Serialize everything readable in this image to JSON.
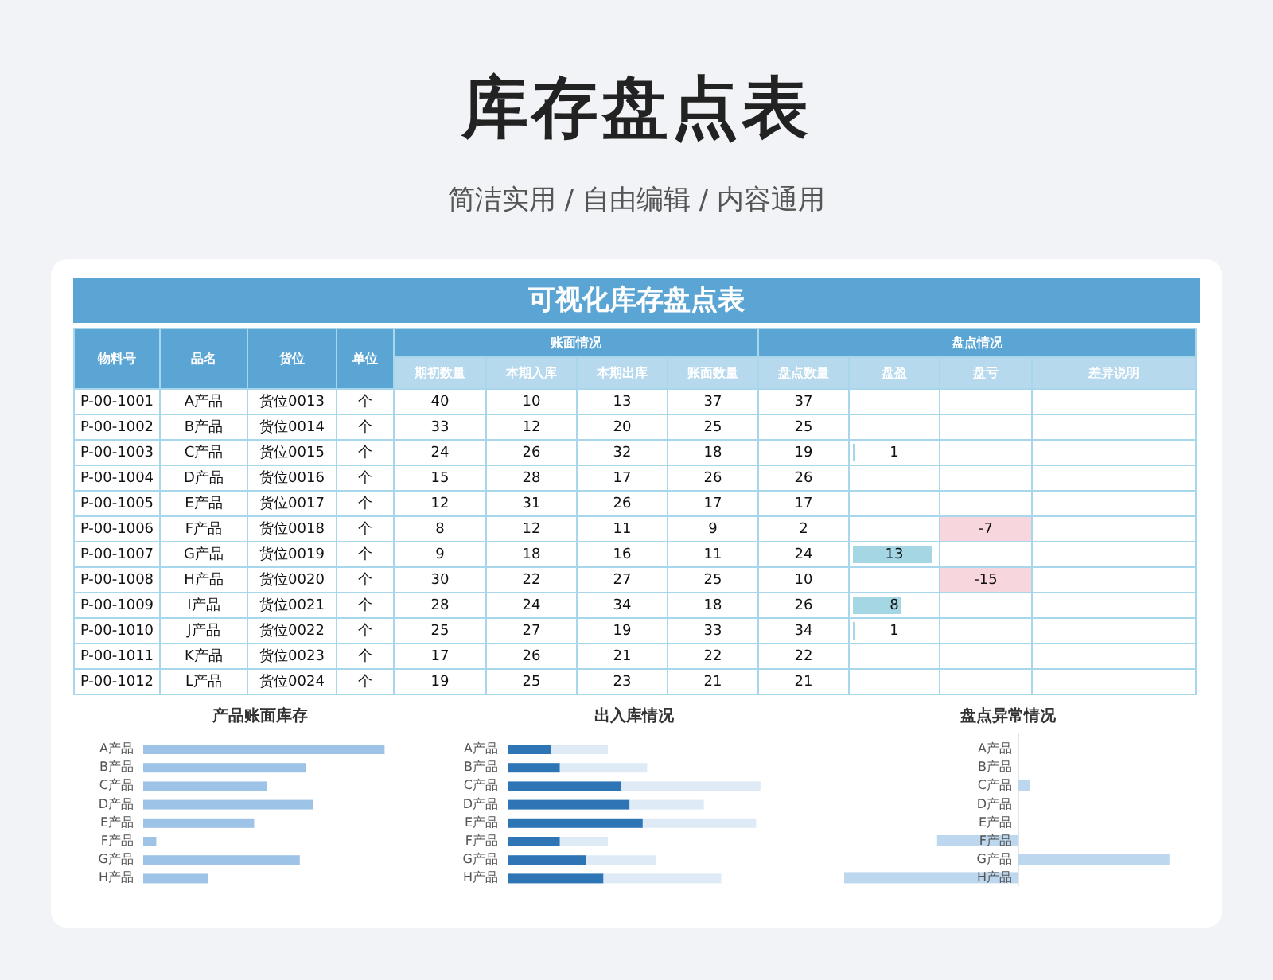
{
  "page_title": "库存盘点表",
  "subtitle": "简洁实用 / 自由编辑 / 内容通用",
  "sheet_title": "可视化库存盘点表",
  "group_headers": [
    "账面情况",
    "盘点情况"
  ],
  "columns": [
    "物料号",
    "品名",
    "货位",
    "单位",
    "期初数量",
    "本期入库",
    "本期出库",
    "账面数量",
    "盘点数量",
    "盘盈",
    "盘亏",
    "差异说明"
  ],
  "rows": [
    {
      "cells": [
        "P-00-1001",
        "A产品",
        "货位0013",
        "个",
        "40",
        "10",
        "13",
        "37",
        "37"
      ]
    },
    {
      "cells": [
        "P-00-1002",
        "B产品",
        "货位0014",
        "个",
        "33",
        "12",
        "20",
        "25",
        "25"
      ]
    },
    {
      "cells": [
        "P-00-1003",
        "C产品",
        "货位0015",
        "个",
        "24",
        "26",
        "32",
        "18",
        "19"
      ],
      "surplus": {
        "text": "1",
        "level": 0.08
      }
    },
    {
      "cells": [
        "P-00-1004",
        "D产品",
        "货位0016",
        "个",
        "15",
        "28",
        "17",
        "26",
        "26"
      ]
    },
    {
      "cells": [
        "P-00-1005",
        "E产品",
        "货位0017",
        "个",
        "12",
        "31",
        "26",
        "17",
        "17"
      ]
    },
    {
      "cells": [
        "P-00-1006",
        "F产品",
        "货位0018",
        "个",
        "8",
        "12",
        "11",
        "9",
        "2"
      ],
      "loss": "-7"
    },
    {
      "cells": [
        "P-00-1007",
        "G产品",
        "货位0019",
        "个",
        "9",
        "18",
        "16",
        "11",
        "24"
      ],
      "surplus": {
        "text": "13",
        "level": 0.97
      }
    },
    {
      "cells": [
        "P-00-1008",
        "H产品",
        "货位0020",
        "个",
        "30",
        "22",
        "27",
        "25",
        "10"
      ],
      "loss": "-15"
    },
    {
      "cells": [
        "P-00-1009",
        "I产品",
        "货位0021",
        "个",
        "28",
        "24",
        "34",
        "18",
        "26"
      ],
      "surplus": {
        "text": "8",
        "level": 0.6
      }
    },
    {
      "cells": [
        "P-00-1010",
        "J产品",
        "货位0022",
        "个",
        "25",
        "27",
        "19",
        "33",
        "34"
      ],
      "surplus": {
        "text": "1",
        "level": 0.08
      }
    },
    {
      "cells": [
        "P-00-1011",
        "K产品",
        "货位0023",
        "个",
        "17",
        "26",
        "21",
        "22",
        "22"
      ]
    },
    {
      "cells": [
        "P-00-1012",
        "L产品",
        "货位0024",
        "个",
        "19",
        "25",
        "23",
        "21",
        "21"
      ]
    }
  ],
  "charts": [
    {
      "kind": "book",
      "title": "产品账面库存",
      "labels": [
        "A产品",
        "B产品",
        "C产品",
        "D产品",
        "E产品",
        "F产品",
        "G产品",
        "H产品"
      ]
    },
    {
      "kind": "flow",
      "title": "出入库情况",
      "labels": [
        "A产品",
        "B产品",
        "C产品",
        "D产品",
        "E产品",
        "F产品",
        "G产品",
        "H产品"
      ]
    },
    {
      "kind": "diff",
      "title": "盘点异常情况",
      "labels": [
        "A产品",
        "B产品",
        "C产品",
        "D产品",
        "E产品",
        "F产品",
        "G产品",
        "H产品"
      ]
    }
  ]
}
